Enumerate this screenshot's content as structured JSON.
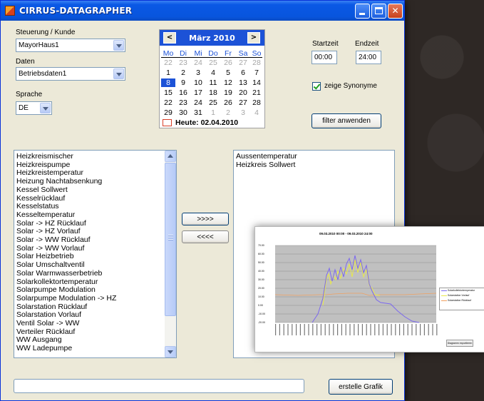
{
  "window": {
    "title": "CIRRUS-DATAGRAPHER"
  },
  "form": {
    "customer_label": "Steuerung / Kunde",
    "customer_value": "MayorHaus1",
    "data_label": "Daten",
    "data_value": "Betriebsdaten1",
    "language_label": "Sprache",
    "language_value": "DE",
    "start_label": "Startzeit",
    "start_value": "00:00",
    "end_label": "Endzeit",
    "end_value": "24:00",
    "synonyms_label": "zeige Synonyme",
    "synonyms_checked": true,
    "filter_button": "filter anwenden",
    "add_button": ">>>>",
    "remove_button": "<<<<",
    "create_button": "erstelle Grafik"
  },
  "calendar": {
    "month": "März 2010",
    "weekdays": [
      "Mo",
      "Di",
      "Mi",
      "Do",
      "Fr",
      "Sa",
      "So"
    ],
    "weeks": [
      [
        "22",
        "23",
        "24",
        "25",
        "26",
        "27",
        "28"
      ],
      [
        "1",
        "2",
        "3",
        "4",
        "5",
        "6",
        "7"
      ],
      [
        "8",
        "9",
        "10",
        "11",
        "12",
        "13",
        "14"
      ],
      [
        "15",
        "16",
        "17",
        "18",
        "19",
        "20",
        "21"
      ],
      [
        "22",
        "23",
        "24",
        "25",
        "26",
        "27",
        "28"
      ],
      [
        "29",
        "30",
        "31",
        "1",
        "2",
        "3",
        "4"
      ]
    ],
    "selected": "8",
    "today": "Heute: 02.04.2010"
  },
  "available_list": [
    "Heizkreismischer",
    "Heizkreispumpe",
    "Heizkreistemperatur",
    "Heizung Nachtabsenkung",
    "Kessel Sollwert",
    "Kesselrücklauf",
    "Kesselstatus",
    "Kesseltemperatur",
    "Solar -> HZ Rücklauf",
    "Solar -> HZ Vorlauf",
    "Solar -> WW Rücklauf",
    "Solar -> WW Vorlauf",
    "Solar Heizbetrieb",
    "Solar Umschaltventil",
    "Solar Warmwasserbetrieb",
    "Solarkollektortemperatur",
    "Solarpumpe Modulation",
    "Solarpumpe Modulation -> HZ",
    "Solarstation Rücklauf",
    "Solarstation Vorlauf",
    "Ventil Solar -> WW",
    "Verteiler Rücklauf",
    "WW Ausgang",
    "WW Ladepumpe"
  ],
  "selected_list": [
    "Aussentemperatur",
    "Heizkreis Sollwert"
  ],
  "status_text": "",
  "preview_chart": {
    "title": "09.03.2010 00:00 - 09.03.2010 24:00",
    "legend": [
      "Solarkollektortemperatur",
      "Solarstation Vorlauf",
      "Solarstation Rücklauf"
    ],
    "colors": [
      "#7b68ee",
      "#e8e84a",
      "#f0a060",
      "#5b7fc8"
    ],
    "y_ticks": [
      "70.00",
      "60.00",
      "50.00",
      "40.00",
      "30.00",
      "20.00",
      "10.00",
      "0.00",
      "-10.00",
      "-20.00"
    ],
    "export_button": "Diagramm exportieren"
  }
}
